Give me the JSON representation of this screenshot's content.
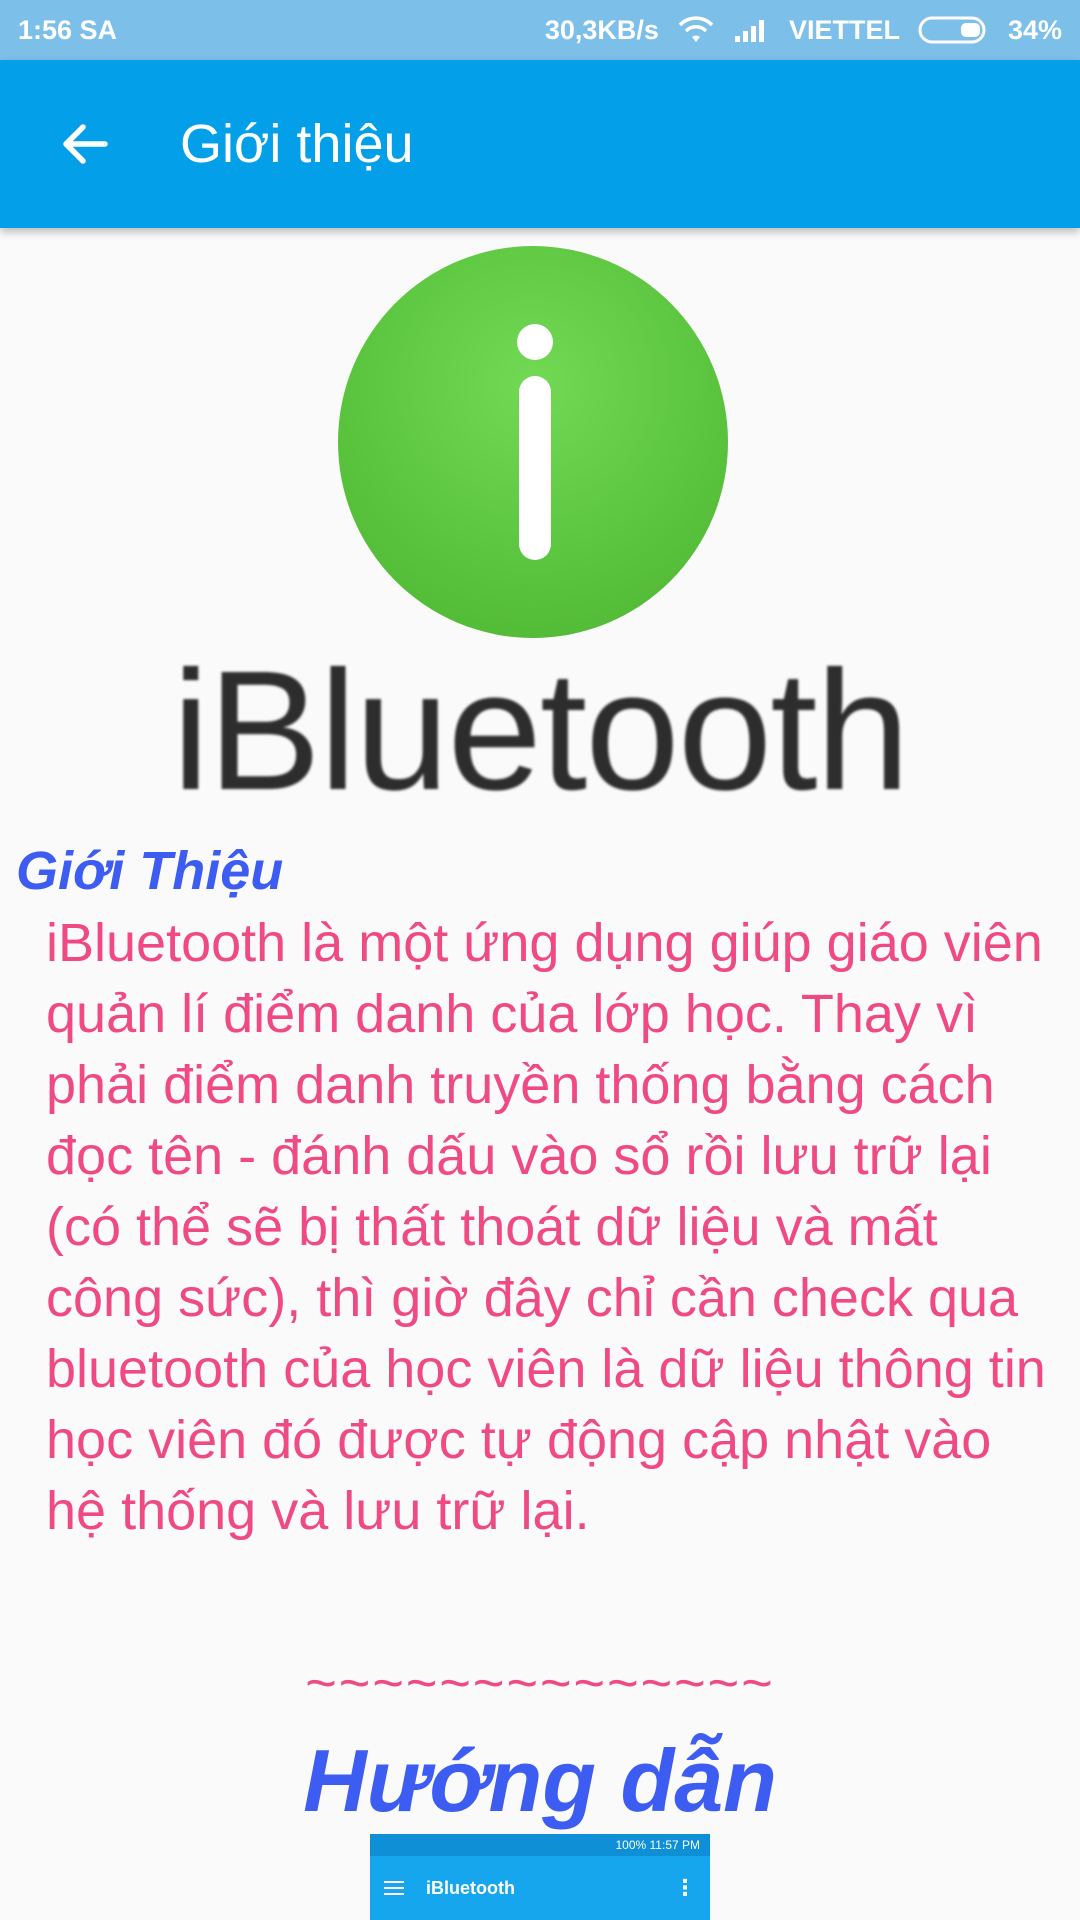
{
  "status_bar": {
    "time": "1:56 SA",
    "speed": "30,3KB/s",
    "carrier": "VIETTEL",
    "battery": "34%",
    "battery_level": 0.34,
    "icons": [
      "wifi-icon",
      "signal-icon",
      "battery-icon"
    ]
  },
  "app_bar": {
    "title": "Giới thiệu",
    "back_icon": "arrow-back-icon",
    "color": "#03a0e9"
  },
  "logo": {
    "wordmark": "iBluetooth",
    "icon": "info-circle-icon",
    "color": "#5cc53f"
  },
  "intro": {
    "heading": "Giới Thiệu",
    "body": "iBluetooth là một ứng dụng giúp giáo viên quản lí điểm danh của lớp học. Thay vì phải điểm danh truyền thống bằng cách đọc tên - đánh dấu vào sổ rồi lưu trữ lại (có thể sẽ bị thất thoát dữ liệu và mất công sức), thì giờ đây chỉ cần check qua bluetooth của học viên là dữ liệu thông tin học viên đó được tự động cập nhật vào hệ thống và lưu trữ lại.",
    "divider": "~~~~~~~~~~~~~~",
    "heading_color": "#3d5cf2",
    "body_color": "#ef4a84"
  },
  "guide": {
    "title": "Hướng dẫn",
    "embedded_screenshot": {
      "status_text": "100% 11:57 PM",
      "app_title": "iBluetooth",
      "icons": [
        "menu-icon",
        "more-vert-icon"
      ]
    }
  }
}
